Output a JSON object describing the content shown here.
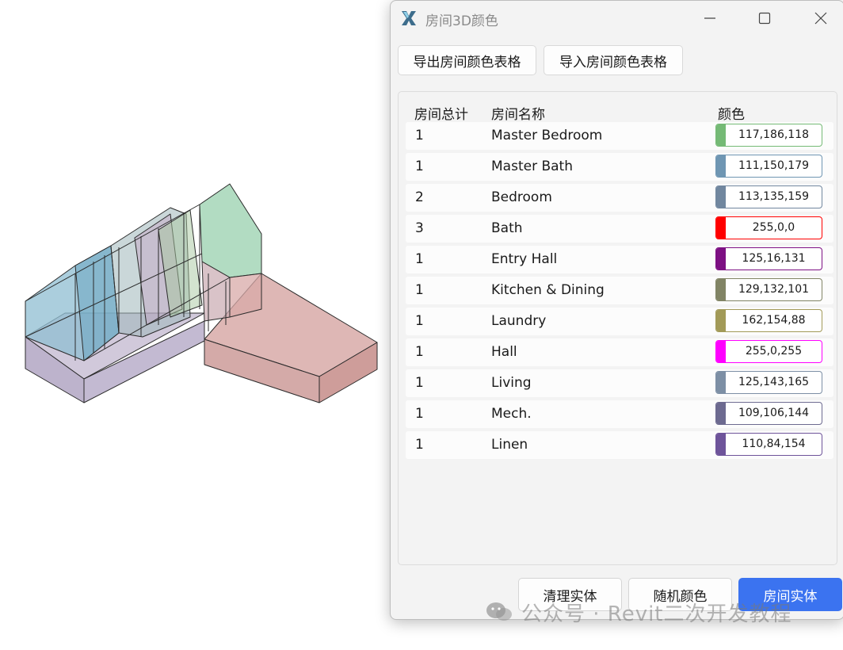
{
  "window": {
    "title": "房间3D颜色",
    "minimize_icon": "minimize-icon",
    "maximize_icon": "maximize-icon",
    "close_icon": "close-icon"
  },
  "toolbar": {
    "export_label": "导出房间颜色表格",
    "import_label": "导入房间颜色表格"
  },
  "table": {
    "headers": {
      "count": "房间总计",
      "name": "房间名称",
      "color": "颜色"
    },
    "rows": [
      {
        "count": "1",
        "name": "Master Bedroom",
        "color_text": "117,186,118",
        "color": "#75ba76"
      },
      {
        "count": "1",
        "name": "Master Bath",
        "color_text": "111,150,179",
        "color": "#6f96b3"
      },
      {
        "count": "2",
        "name": "Bedroom",
        "color_text": "113,135,159",
        "color": "#71879f"
      },
      {
        "count": "3",
        "name": "Bath",
        "color_text": "255,0,0",
        "color": "#ff0000"
      },
      {
        "count": "1",
        "name": "Entry Hall",
        "color_text": "125,16,131",
        "color": "#7d1083"
      },
      {
        "count": "1",
        "name": "Kitchen & Dining",
        "color_text": "129,132,101",
        "color": "#818465"
      },
      {
        "count": "1",
        "name": "Laundry",
        "color_text": "162,154,88",
        "color": "#a29a58"
      },
      {
        "count": "1",
        "name": "Hall",
        "color_text": "255,0,255",
        "color": "#ff00ff"
      },
      {
        "count": "1",
        "name": "Living",
        "color_text": "125,143,165",
        "color": "#7d8fa5"
      },
      {
        "count": "1",
        "name": "Mech.",
        "color_text": "109,106,144",
        "color": "#6d6a90"
      },
      {
        "count": "1",
        "name": "Linen",
        "color_text": "110,84,154",
        "color": "#6e549a"
      }
    ]
  },
  "buttons": {
    "clear_label": "清理实体",
    "random_label": "随机颜色",
    "room_label": "房间实体"
  },
  "watermark": {
    "text": "公众号 · Revit二次开发教程"
  },
  "colors": {
    "accent": "#3b73f0",
    "window_bg": "#f3f3f3"
  }
}
